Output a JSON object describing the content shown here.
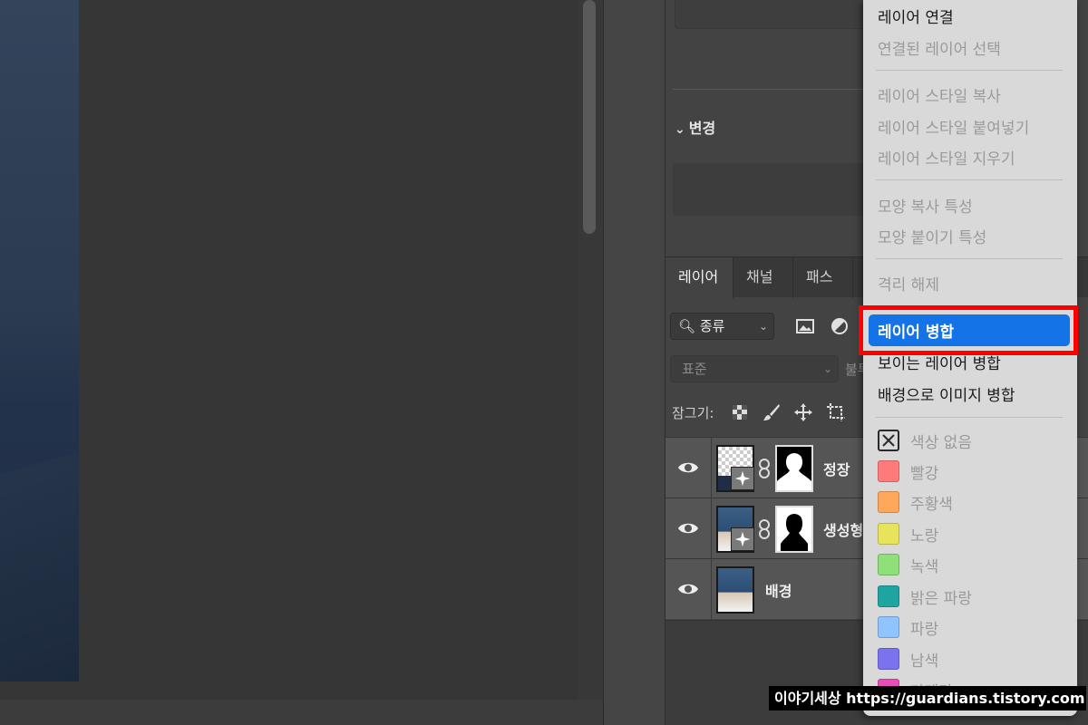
{
  "properties": {
    "change_header": "변경"
  },
  "tabs": [
    {
      "label": "레이어"
    },
    {
      "label": "채널"
    },
    {
      "label": "패스"
    }
  ],
  "filter": {
    "kind_label": "종류"
  },
  "blend": {
    "mode": "표준",
    "opacity_label": "불투"
  },
  "lock": {
    "label": "잠그기:"
  },
  "layers": [
    {
      "name": "정장"
    },
    {
      "name": "생성형"
    },
    {
      "name": "배경"
    }
  ],
  "context_menu": {
    "items": [
      {
        "label": "레이어 연결",
        "enabled": true
      },
      {
        "label": "연결된 레이어 선택",
        "enabled": false
      },
      {
        "label": "레이어 스타일 복사",
        "enabled": false
      },
      {
        "label": "레이어 스타일 붙여넣기",
        "enabled": false
      },
      {
        "label": "레이어 스타일 지우기",
        "enabled": false
      },
      {
        "label": "모양 복사 특성",
        "enabled": false
      },
      {
        "label": "모양 붙이기 특성",
        "enabled": false
      },
      {
        "label": "격리 해제",
        "enabled": false
      },
      {
        "label": "레이어 병합",
        "enabled": true,
        "highlighted": true
      },
      {
        "label": "보이는 레이어 병합",
        "enabled": true
      },
      {
        "label": "배경으로 이미지 병합",
        "enabled": true
      }
    ],
    "colors": [
      {
        "label": "색상 없음",
        "color": "none"
      },
      {
        "label": "빨강",
        "color": "#ff7b7b"
      },
      {
        "label": "주황색",
        "color": "#ffa85c"
      },
      {
        "label": "노랑",
        "color": "#e8e35c"
      },
      {
        "label": "녹색",
        "color": "#8fe07a"
      },
      {
        "label": "밝은 파랑",
        "color": "#1fa5a0"
      },
      {
        "label": "파랑",
        "color": "#8fc4ff"
      },
      {
        "label": "남색",
        "color": "#7a72ef"
      },
      {
        "label": "마젠타",
        "color": "#e94db7"
      }
    ]
  },
  "watermark": "이야기세상 https://guardians.tistory.com"
}
